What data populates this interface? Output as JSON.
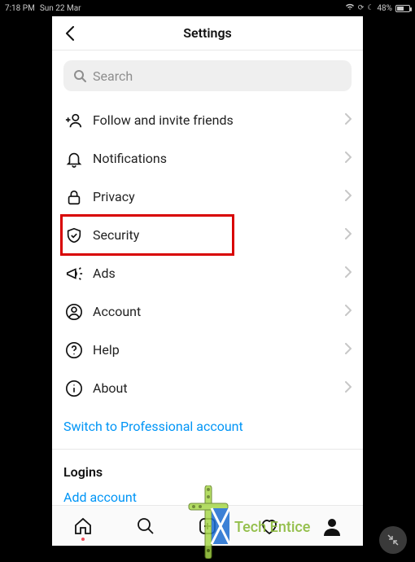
{
  "statusbar": {
    "time": "7:18 PM",
    "date": "Sun 22 Mar",
    "battery": "48%"
  },
  "header": {
    "title": "Settings"
  },
  "search": {
    "placeholder": "Search"
  },
  "settings_items": [
    {
      "label": "Follow and invite friends"
    },
    {
      "label": "Notifications"
    },
    {
      "label": "Privacy"
    },
    {
      "label": "Security"
    },
    {
      "label": "Ads"
    },
    {
      "label": "Account"
    },
    {
      "label": "Help"
    },
    {
      "label": "About"
    }
  ],
  "links": {
    "switch_pro": "Switch to Professional account",
    "add_account": "Add account"
  },
  "sections": {
    "logins": "Logins"
  },
  "watermark": "Tech Entice"
}
